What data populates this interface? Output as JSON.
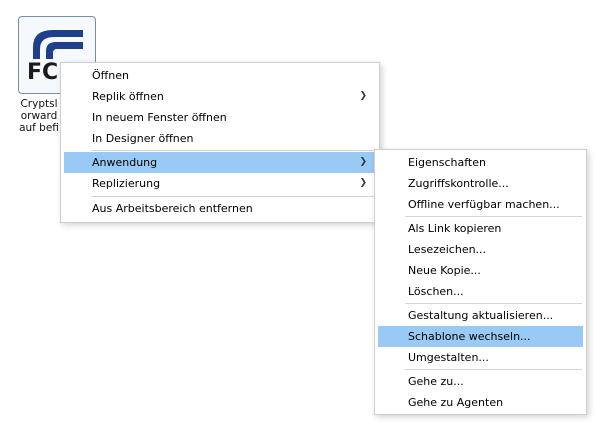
{
  "workspace": {
    "icon_text": "FC",
    "label_lines": [
      "Cryptsl",
      "orward",
      "auf befi"
    ]
  },
  "context_menu": {
    "items": [
      {
        "label": "Öffnen"
      },
      {
        "label": "Replik öffnen",
        "submenu": true
      },
      {
        "label": "In neuem Fenster öffnen"
      },
      {
        "label": "In Designer öffnen"
      },
      {
        "label": "Anwendung",
        "submenu": true,
        "highlighted": true
      },
      {
        "label": "Replizierung",
        "submenu": true
      },
      {
        "label": "Aus Arbeitsbereich entfernen"
      }
    ]
  },
  "submenu": {
    "items": [
      {
        "label": "Eigenschaften"
      },
      {
        "label": "Zugriffskontrolle..."
      },
      {
        "label": "Offline verfügbar machen..."
      },
      {
        "label": "Als Link kopieren"
      },
      {
        "label": "Lesezeichen..."
      },
      {
        "label": "Neue Kopie..."
      },
      {
        "label": "Löschen..."
      },
      {
        "label": "Gestaltung aktualisieren..."
      },
      {
        "label": "Schablone wechseln...",
        "highlighted": true
      },
      {
        "label": "Umgestalten..."
      },
      {
        "label": "Gehe zu..."
      },
      {
        "label": "Gehe zu Agenten"
      }
    ]
  },
  "icons": {
    "submenu_arrow": "chevron-right-icon",
    "app_logo": "app-logo-icon"
  },
  "colors": {
    "highlight": "#99c9f5",
    "logo_blue": "#1f3e8c"
  }
}
